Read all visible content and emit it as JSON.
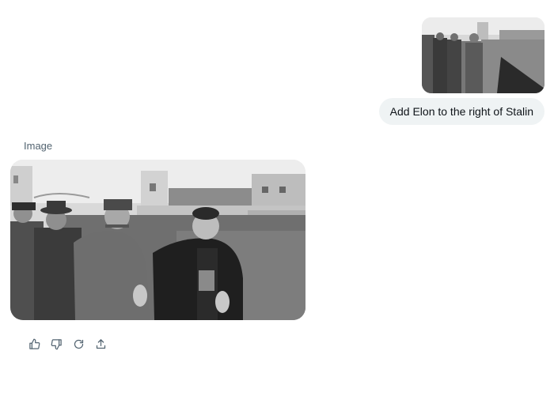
{
  "conversation": {
    "user_message": {
      "text": "Add Elon to the right of Stalin"
    },
    "response": {
      "label": "Image"
    },
    "actions": [
      {
        "name": "like",
        "icon": "thumbs-up-icon"
      },
      {
        "name": "dislike",
        "icon": "thumbs-down-icon"
      },
      {
        "name": "regenerate",
        "icon": "refresh-icon"
      },
      {
        "name": "share",
        "icon": "share-icon"
      }
    ]
  },
  "colors": {
    "bubble_background": "#eff3f4",
    "secondary_text": "#536471",
    "primary_text": "#0f1419"
  }
}
